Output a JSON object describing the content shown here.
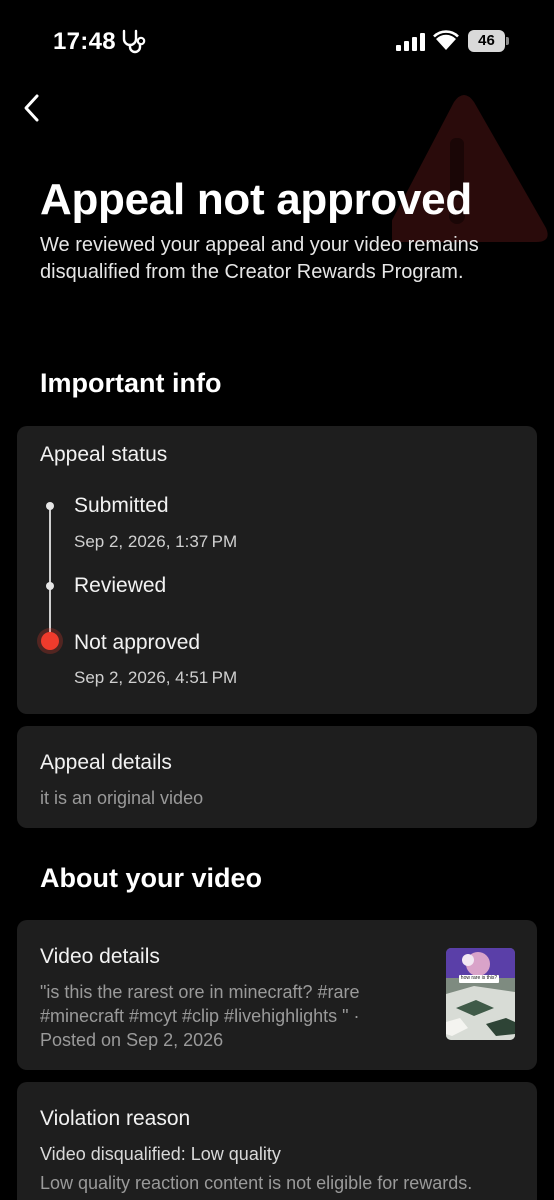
{
  "status_bar": {
    "time": "17:48",
    "battery_level": "46",
    "icons": [
      "stethoscope-icon",
      "signal-icon",
      "wifi-icon",
      "battery-icon"
    ]
  },
  "header": {
    "title": "Appeal not approved",
    "subtitle": "We reviewed your appeal and your video remains disqualified from the Creator Rewards Program.",
    "icons": [
      "back-arrow-icon",
      "warning-triangle-icon"
    ]
  },
  "important_info": {
    "heading": "Important info",
    "appeal_status": {
      "title": "Appeal status",
      "steps": [
        {
          "label": "Submitted",
          "date": "Sep 2, 2026, 1:37 PM"
        },
        {
          "label": "Reviewed",
          "date": ""
        },
        {
          "label": "Not approved",
          "date": "Sep 2, 2026, 4:51 PM"
        }
      ]
    },
    "appeal_details": {
      "title": "Appeal details",
      "text": "it is an original video"
    }
  },
  "about_video": {
    "heading": "About your video",
    "video_details": {
      "title": "Video details",
      "line1": "\"is this the rarest ore in minecraft? #rare",
      "line2": "#minecraft #mcyt #clip #livehighlights \" ·",
      "line3": "Posted on Sep 2, 2026",
      "thumbnail_caption": "how rare is this?"
    },
    "violation": {
      "title": "Violation reason",
      "reason": "Video disqualified: Low quality",
      "explanation": "Low quality reaction content is not eligible for rewards."
    }
  },
  "colors": {
    "background": "#000000",
    "card": "#1e1e1e",
    "accent_red": "#ef3b2c",
    "muted_text": "#9a9a9a"
  }
}
